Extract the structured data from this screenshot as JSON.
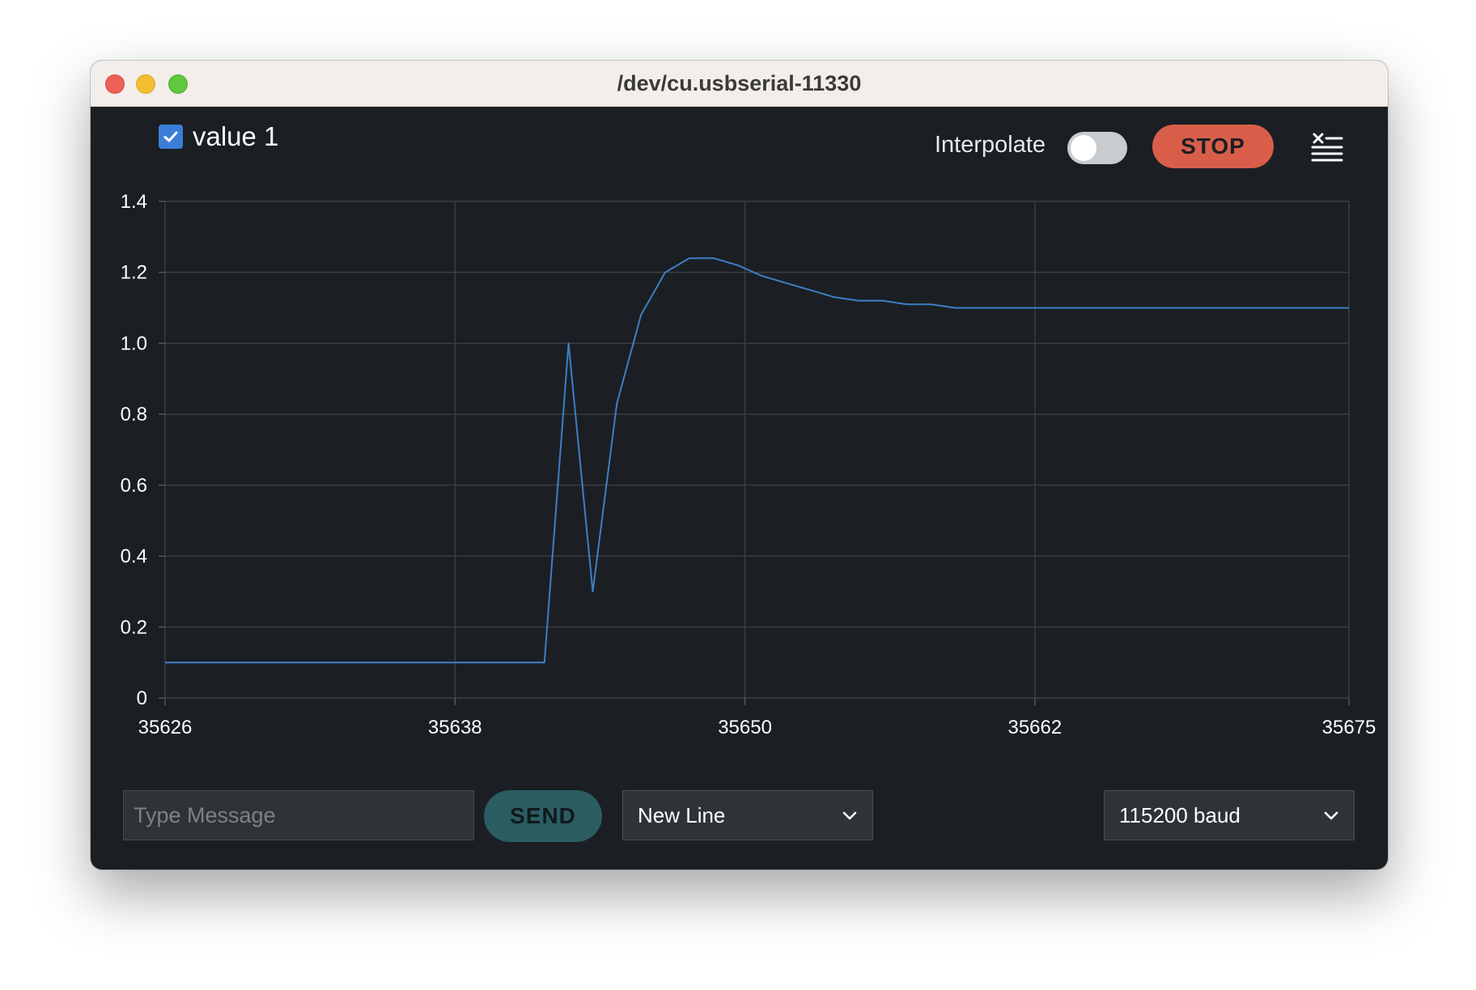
{
  "window": {
    "title": "/dev/cu.usbserial-11330"
  },
  "legend": {
    "series_label": "value 1",
    "checked": true
  },
  "controls": {
    "interpolate_label": "Interpolate",
    "interpolate_on": false,
    "stop_label": "STOP",
    "clear_icon": "clear-list-icon"
  },
  "footer": {
    "message_placeholder": "Type Message",
    "send_label": "SEND",
    "line_ending": "New Line",
    "baud_rate": "115200 baud"
  },
  "colors": {
    "series": "#3d7fc4",
    "stop": "#d95e4a",
    "send": "#2b5d63",
    "checkbox": "#3b7ed8"
  },
  "chart_data": {
    "type": "line",
    "title": "",
    "xlabel": "",
    "ylabel": "",
    "xlim": [
      35626,
      35675
    ],
    "ylim": [
      0,
      1.4
    ],
    "x_ticks": [
      35626,
      35638,
      35650,
      35662,
      35675
    ],
    "y_ticks": [
      0,
      0.2,
      0.4,
      0.6,
      0.8,
      1.0,
      1.2,
      1.4
    ],
    "y_tick_labels": [
      "0",
      "0.2",
      "0.4",
      "0.6",
      "0.8",
      "1.0",
      "1.2",
      "1.4"
    ],
    "grid": true,
    "series": [
      {
        "name": "value 1",
        "x": [
          35626,
          35630,
          35634,
          35638,
          35641.7,
          35642.7,
          35643.7,
          35644.7,
          35645.7,
          35646.7,
          35647.7,
          35648.7,
          35649.7,
          35650.7,
          35651.7,
          35652.7,
          35653.7,
          35654.7,
          35655.7,
          35656.7,
          35657.7,
          35658.7,
          35660,
          35665,
          35670,
          35675
        ],
        "values": [
          0.1,
          0.1,
          0.1,
          0.1,
          0.1,
          1.0,
          0.3,
          0.83,
          1.08,
          1.2,
          1.24,
          1.24,
          1.22,
          1.19,
          1.17,
          1.15,
          1.13,
          1.12,
          1.12,
          1.11,
          1.11,
          1.1,
          1.1,
          1.1,
          1.1,
          1.1
        ]
      }
    ]
  }
}
